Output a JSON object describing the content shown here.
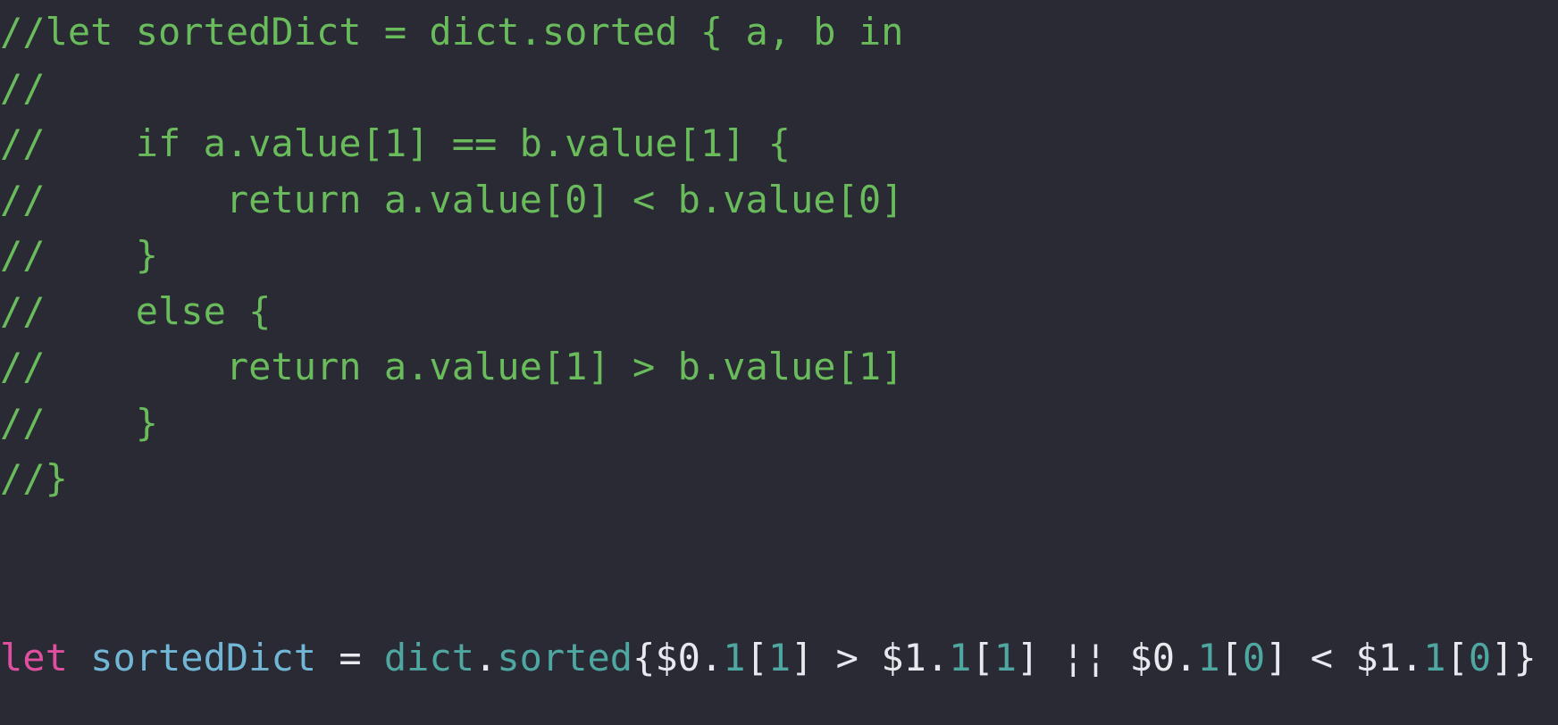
{
  "colors": {
    "background": "#292a33",
    "comment": "#69bb5b",
    "keyword": "#df4f9f",
    "identifier": "#72b6d6",
    "member": "#4fa7a1",
    "plain": "#e8e8ee"
  },
  "comment_lines": [
    "//let sortedDict = dict.sorted { a, b in",
    "//",
    "//    if a.value[1] == b.value[1] {",
    "//        return a.value[0] < b.value[0]",
    "//    }",
    "//    else {",
    "//        return a.value[1] > b.value[1]",
    "//    }",
    "//}"
  ],
  "code_line": {
    "kw": "let",
    "sp1": " ",
    "name": "sortedDict",
    "eq": " = ",
    "obj": "dict",
    "dot": ".",
    "method": "sorted",
    "t1": "{$0.",
    "n1": "1",
    "t2": "[",
    "n2": "1",
    "t3": "] > $1.",
    "n3": "1",
    "t4": "[",
    "n4": "1",
    "t5": "] ¦¦ $0.",
    "n5": "1",
    "t6": "[",
    "n6": "0",
    "t7": "] < $1.",
    "n7": "1",
    "t8": "[",
    "n8": "0",
    "t9": "]}"
  }
}
